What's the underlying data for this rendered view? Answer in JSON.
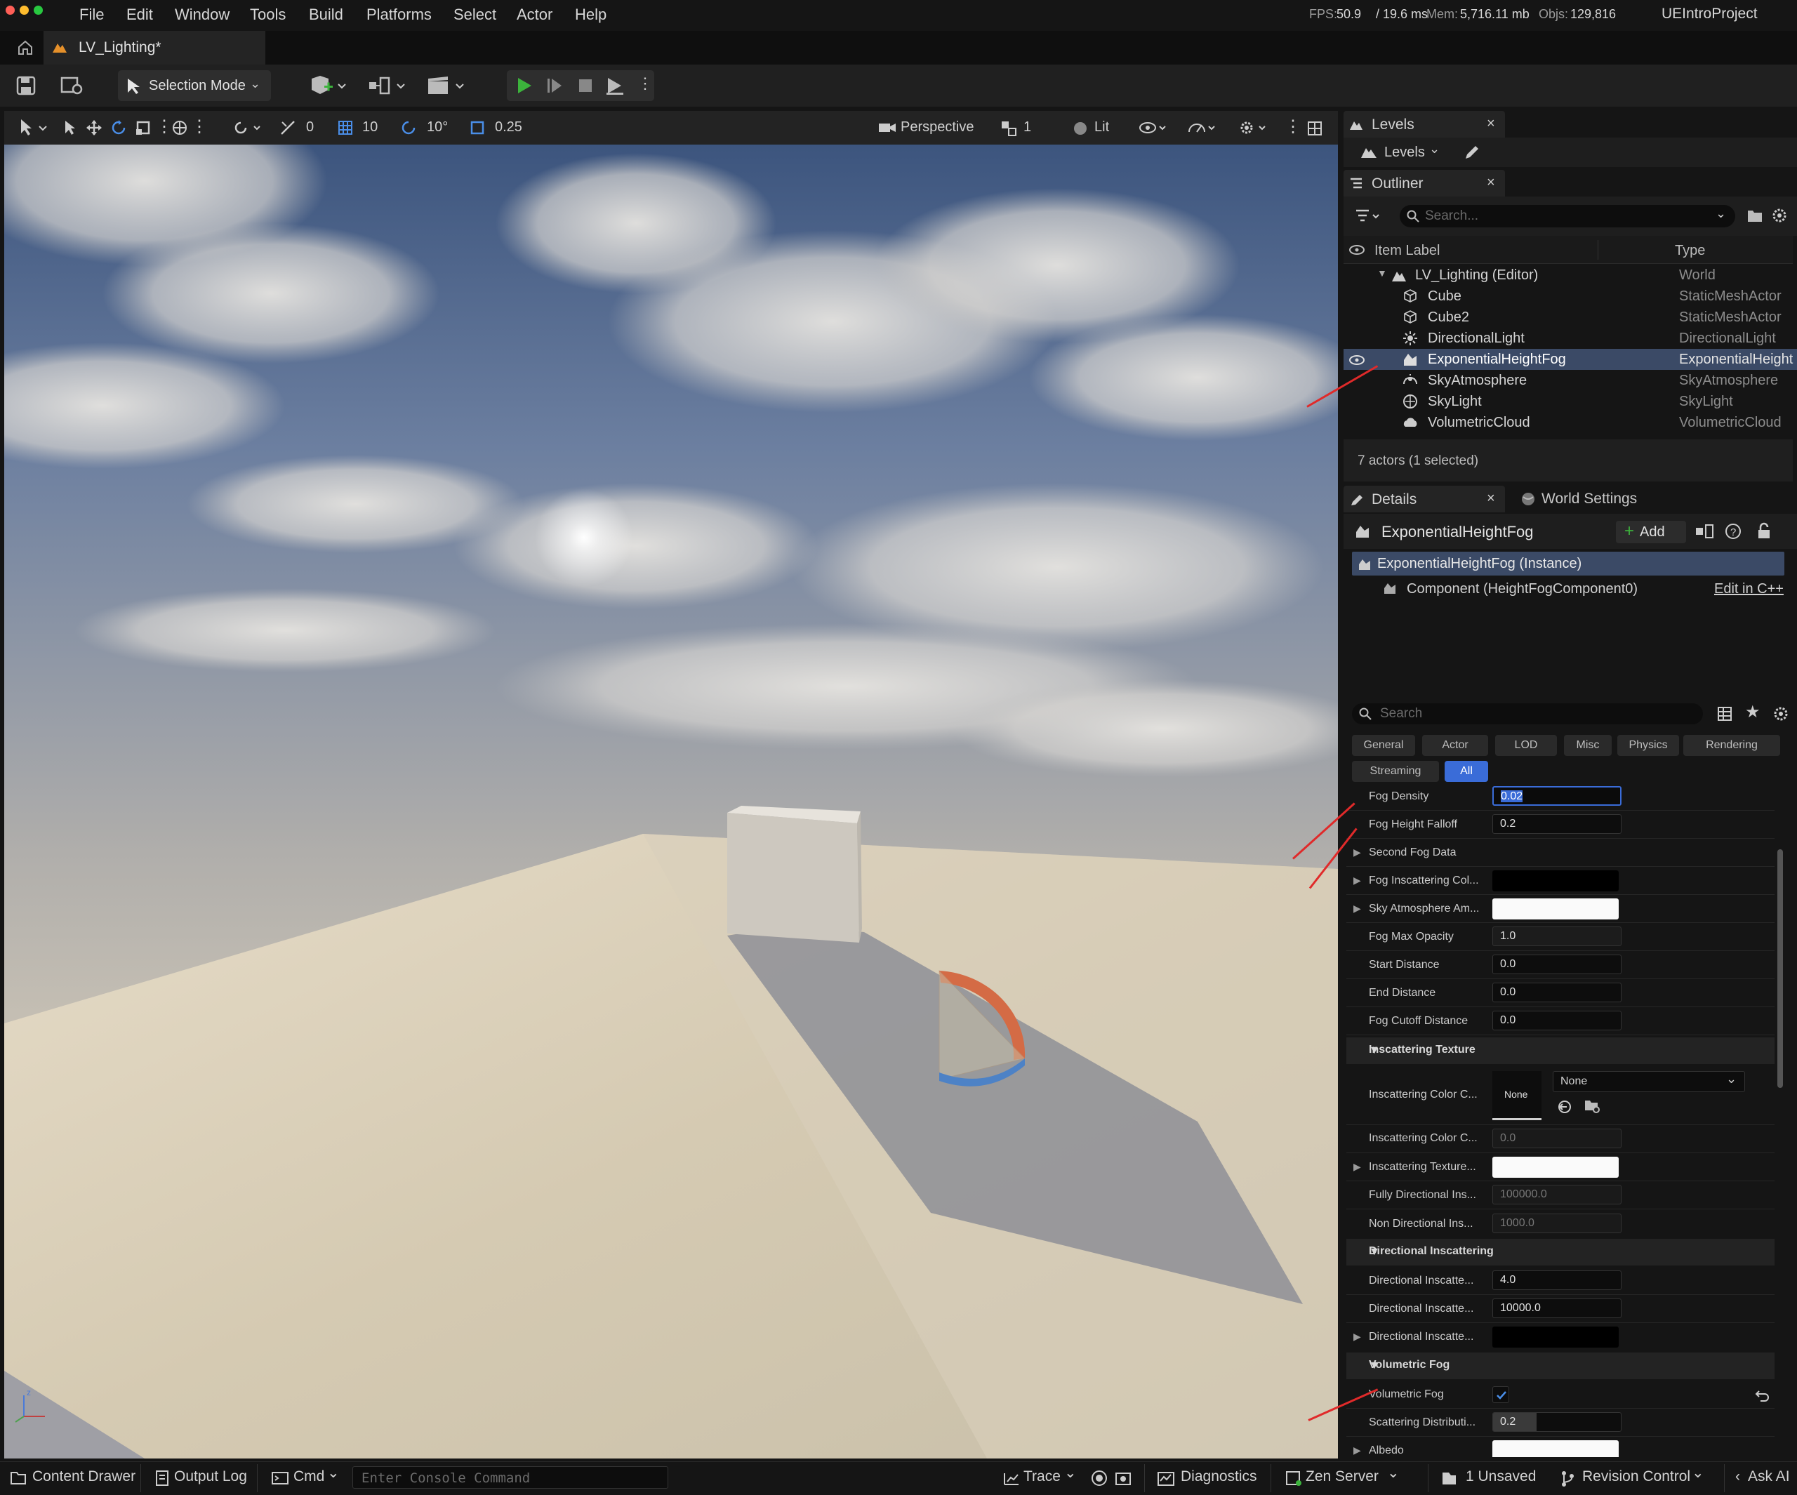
{
  "menubar": {
    "items": [
      "File",
      "Edit",
      "Window",
      "Tools",
      "Build",
      "Platforms",
      "Select",
      "Actor",
      "Help"
    ],
    "fps_label": "FPS:",
    "fps_value": "50.9",
    "frame_ms": "/ 19.6 ms",
    "mem_label": "Mem:",
    "mem_value": "5,716.11 mb",
    "objs_label": "Objs:",
    "objs_value": "129,816",
    "project": "UEIntroProject"
  },
  "tabs": {
    "level_tab": "LV_Lighting*"
  },
  "toolbar": {
    "selection_mode": "Selection Mode"
  },
  "viewport_toolbar": {
    "rotation_snap": "0",
    "grid_snap": "10",
    "angle_snap": "10°",
    "scale_snap": "0.25",
    "view_mode": "Perspective",
    "camera_speed": "1",
    "lit": "Lit"
  },
  "levels": {
    "tab_title": "Levels",
    "dropdown": "Levels"
  },
  "outliner": {
    "tab_title": "Outliner",
    "search_placeholder": "Search...",
    "col_label": "Item Label",
    "col_type": "Type",
    "world_label": "LV_Lighting (Editor)",
    "world_type": "World",
    "rows": [
      {
        "label": "Cube",
        "type": "StaticMeshActor"
      },
      {
        "label": "Cube2",
        "type": "StaticMeshActor"
      },
      {
        "label": "DirectionalLight",
        "type": "DirectionalLight"
      },
      {
        "label": "ExponentialHeightFog",
        "type": "ExponentialHeight"
      },
      {
        "label": "SkyAtmosphere",
        "type": "SkyAtmosphere"
      },
      {
        "label": "SkyLight",
        "type": "SkyLight"
      },
      {
        "label": "VolumetricCloud",
        "type": "VolumetricCloud"
      }
    ],
    "footer": "7 actors (1 selected)"
  },
  "details": {
    "tab_title": "Details",
    "world_settings": "World Settings",
    "actor_name": "ExponentialHeightFog",
    "add_label": "Add",
    "instance_label": "ExponentialHeightFog (Instance)",
    "component_label": "Component (HeightFogComponent0)",
    "edit_cpp": "Edit in C++",
    "search_placeholder": "Search",
    "filters": [
      "General",
      "Actor",
      "LOD",
      "Misc",
      "Physics",
      "Rendering"
    ],
    "filters2": [
      "Streaming",
      "All"
    ],
    "props": [
      {
        "label": "Fog Density",
        "value": "0.02"
      },
      {
        "label": "Fog Height Falloff",
        "value": "0.2"
      },
      {
        "label": "Second Fog Data",
        "value": ""
      },
      {
        "label": "Fog Inscattering Col...",
        "value": ""
      },
      {
        "label": "Sky Atmosphere Am...",
        "value": ""
      },
      {
        "label": "Fog Max Opacity",
        "value": "1.0"
      },
      {
        "label": "Start Distance",
        "value": "0.0"
      },
      {
        "label": "End Distance",
        "value": "0.0"
      },
      {
        "label": "Fog Cutoff Distance",
        "value": "0.0"
      }
    ],
    "sec_inscattering": "Inscattering Texture",
    "insc_color_c1": "Inscattering Color C...",
    "none_thumb": "None",
    "none_dropdown": "None",
    "insc_color_c2": "Inscattering Color C...",
    "insc_color_c2_value": "0.0",
    "insc_texture": "Inscattering Texture...",
    "fully_dir": "Fully Directional Ins...",
    "fully_dir_value": "100000.0",
    "non_dir": "Non Directional Ins...",
    "non_dir_value": "1000.0",
    "sec_directional": "Directional Inscattering",
    "dir1": "Directional Inscatte...",
    "dir1_value": "4.0",
    "dir2": "Directional Inscatte...",
    "dir2_value": "10000.0",
    "dir3": "Directional Inscatte...",
    "sec_volumetric": "Volumetric Fog",
    "vol_fog": "Volumetric Fog",
    "scatter": "Scattering Distributi...",
    "scatter_value": "0.2",
    "albedo": "Albedo"
  },
  "statusbar": {
    "content_drawer": "Content Drawer",
    "output_log": "Output Log",
    "cmd": "Cmd",
    "console_placeholder": "Enter Console Command",
    "trace": "Trace",
    "diagnostics": "Diagnostics",
    "zen_server": "Zen Server",
    "unsaved": "1 Unsaved",
    "revision_control": "Revision Control",
    "ask_ai": "Ask AI"
  },
  "colors": {
    "accent": "#3a6cd8",
    "selected_row": "#3b4a66",
    "play": "#3cb33c",
    "annotation": "#e02a2a"
  }
}
